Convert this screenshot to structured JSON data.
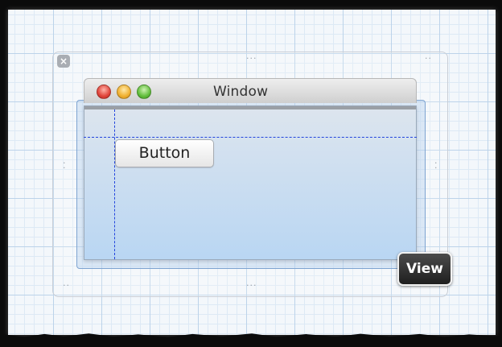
{
  "window": {
    "title": "Window"
  },
  "button": {
    "label": "Button"
  },
  "view_badge": {
    "label": "View"
  },
  "icons": {
    "close": "close-icon",
    "traffic_lights": [
      "close-window-icon",
      "minimize-window-icon",
      "zoom-window-icon"
    ],
    "resize_dots": "resize-handle-icon"
  },
  "colors": {
    "guide": "#2244dd",
    "grid": "#bcd3ea",
    "window_content_top": "#dde5ee",
    "window_content_bottom": "#b9d6f3",
    "view_badge": "#2a2a2a"
  }
}
